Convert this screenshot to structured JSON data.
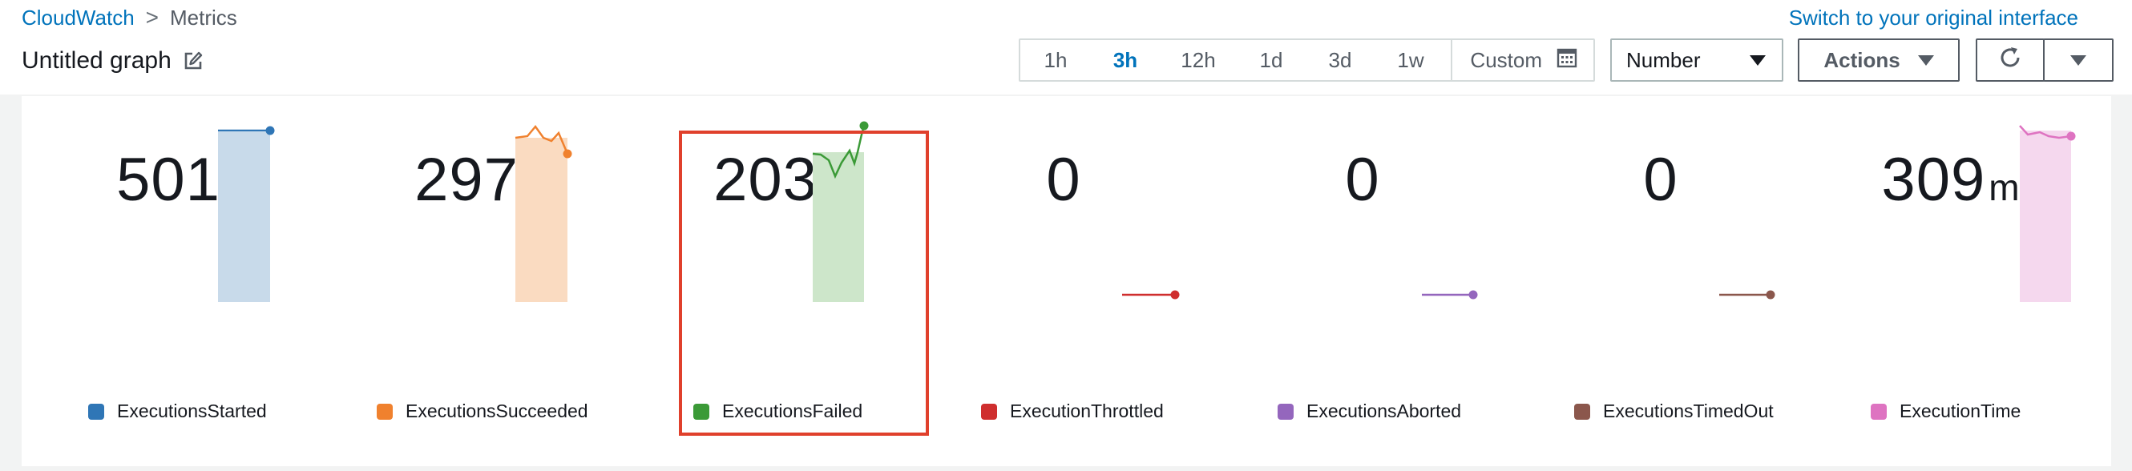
{
  "breadcrumb": {
    "root": "CloudWatch",
    "separator": ">",
    "current": "Metrics"
  },
  "switch_link": "Switch to your original interface",
  "graph": {
    "title": "Untitled graph",
    "edit_icon": "edit-icon"
  },
  "time_range": {
    "options": [
      "1h",
      "3h",
      "12h",
      "1d",
      "3d",
      "1w"
    ],
    "selected": "3h",
    "custom_label": "Custom",
    "custom_icon": "calendar-icon"
  },
  "display_select": {
    "value": "Number"
  },
  "actions": {
    "label": "Actions",
    "refresh_icon": "refresh-icon",
    "more_icon": "chevron-down-icon"
  },
  "colors": {
    "accent": "#0073bb",
    "highlight": "#e0402c"
  },
  "metrics": [
    {
      "name": "ExecutionsStarted",
      "value": "501",
      "unit": "",
      "color": "#2f76b6",
      "fill": "#c8daea",
      "highlighted": false
    },
    {
      "name": "ExecutionsSucceeded",
      "value": "297",
      "unit": "",
      "color": "#f0812e",
      "fill": "#fadbc1",
      "highlighted": false
    },
    {
      "name": "ExecutionsFailed",
      "value": "203",
      "unit": "",
      "color": "#3b9a37",
      "fill": "#cde6ca",
      "highlighted": true
    },
    {
      "name": "ExecutionThrottled",
      "value": "0",
      "unit": "",
      "color": "#cf2e2e",
      "fill": "#f5cccc",
      "highlighted": false
    },
    {
      "name": "ExecutionsAborted",
      "value": "0",
      "unit": "",
      "color": "#9466bd",
      "fill": "#e4d8ef",
      "highlighted": false
    },
    {
      "name": "ExecutionsTimedOut",
      "value": "0",
      "unit": "",
      "color": "#8b574c",
      "fill": "#e2d4d1",
      "highlighted": false
    },
    {
      "name": "ExecutionTime",
      "value": "309",
      "unit": "ms",
      "color": "#de73c1",
      "fill": "#f5d8ee",
      "highlighted": false
    }
  ]
}
